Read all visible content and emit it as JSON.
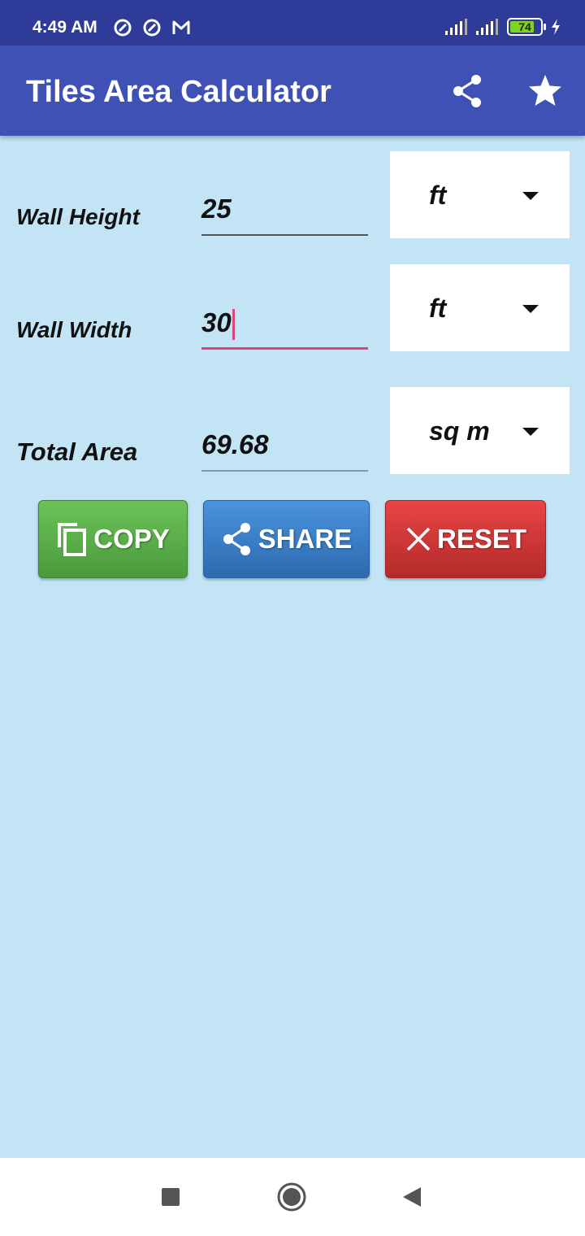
{
  "status_bar": {
    "time": "4:49 AM",
    "battery_level": "74",
    "battery_fraction": 0.74,
    "icons": [
      "data-saver-icon",
      "data-saver-icon",
      "gmail-icon",
      "signal-icon",
      "signal-icon",
      "battery-icon",
      "charging-icon"
    ]
  },
  "app_bar": {
    "title": "Tiles Area Calculator",
    "actions": [
      "share-icon",
      "star-icon"
    ]
  },
  "form": {
    "wall_height": {
      "label": "Wall Height",
      "value": "25",
      "unit": "ft"
    },
    "wall_width": {
      "label": "Wall Width",
      "value": "30",
      "unit": "ft"
    },
    "total_area": {
      "label": "Total Area",
      "value": "69.68",
      "unit": "sq m"
    }
  },
  "buttons": {
    "copy": "COPY",
    "share": "SHARE",
    "reset": "RESET"
  },
  "colors": {
    "status_bar": "#2f3b98",
    "app_bar": "#3f51b5",
    "background": "#c2e4f4",
    "accent": "#e0447a",
    "copy": "#5aad47",
    "share": "#3a7fc6",
    "reset": "#d13636"
  }
}
